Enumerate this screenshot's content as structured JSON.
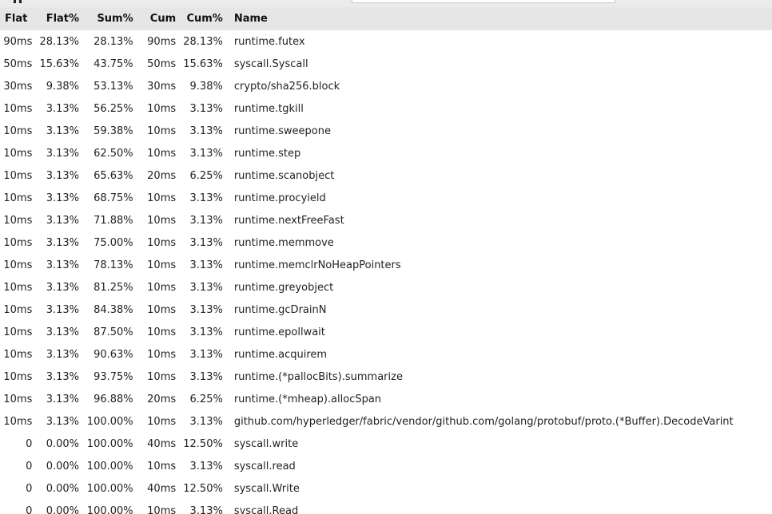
{
  "columns": [
    "Flat",
    "Flat%",
    "Sum%",
    "Cum",
    "Cum%",
    "Name"
  ],
  "rows": [
    {
      "flat": "90ms",
      "flat_pct": "28.13%",
      "sum_pct": "28.13%",
      "cum": "90ms",
      "cum_pct": "28.13%",
      "name": "runtime.futex"
    },
    {
      "flat": "50ms",
      "flat_pct": "15.63%",
      "sum_pct": "43.75%",
      "cum": "50ms",
      "cum_pct": "15.63%",
      "name": "syscall.Syscall"
    },
    {
      "flat": "30ms",
      "flat_pct": "9.38%",
      "sum_pct": "53.13%",
      "cum": "30ms",
      "cum_pct": "9.38%",
      "name": "crypto/sha256.block"
    },
    {
      "flat": "10ms",
      "flat_pct": "3.13%",
      "sum_pct": "56.25%",
      "cum": "10ms",
      "cum_pct": "3.13%",
      "name": "runtime.tgkill"
    },
    {
      "flat": "10ms",
      "flat_pct": "3.13%",
      "sum_pct": "59.38%",
      "cum": "10ms",
      "cum_pct": "3.13%",
      "name": "runtime.sweepone"
    },
    {
      "flat": "10ms",
      "flat_pct": "3.13%",
      "sum_pct": "62.50%",
      "cum": "10ms",
      "cum_pct": "3.13%",
      "name": "runtime.step"
    },
    {
      "flat": "10ms",
      "flat_pct": "3.13%",
      "sum_pct": "65.63%",
      "cum": "20ms",
      "cum_pct": "6.25%",
      "name": "runtime.scanobject"
    },
    {
      "flat": "10ms",
      "flat_pct": "3.13%",
      "sum_pct": "68.75%",
      "cum": "10ms",
      "cum_pct": "3.13%",
      "name": "runtime.procyield"
    },
    {
      "flat": "10ms",
      "flat_pct": "3.13%",
      "sum_pct": "71.88%",
      "cum": "10ms",
      "cum_pct": "3.13%",
      "name": "runtime.nextFreeFast"
    },
    {
      "flat": "10ms",
      "flat_pct": "3.13%",
      "sum_pct": "75.00%",
      "cum": "10ms",
      "cum_pct": "3.13%",
      "name": "runtime.memmove"
    },
    {
      "flat": "10ms",
      "flat_pct": "3.13%",
      "sum_pct": "78.13%",
      "cum": "10ms",
      "cum_pct": "3.13%",
      "name": "runtime.memclrNoHeapPointers"
    },
    {
      "flat": "10ms",
      "flat_pct": "3.13%",
      "sum_pct": "81.25%",
      "cum": "10ms",
      "cum_pct": "3.13%",
      "name": "runtime.greyobject"
    },
    {
      "flat": "10ms",
      "flat_pct": "3.13%",
      "sum_pct": "84.38%",
      "cum": "10ms",
      "cum_pct": "3.13%",
      "name": "runtime.gcDrainN"
    },
    {
      "flat": "10ms",
      "flat_pct": "3.13%",
      "sum_pct": "87.50%",
      "cum": "10ms",
      "cum_pct": "3.13%",
      "name": "runtime.epollwait"
    },
    {
      "flat": "10ms",
      "flat_pct": "3.13%",
      "sum_pct": "90.63%",
      "cum": "10ms",
      "cum_pct": "3.13%",
      "name": "runtime.acquirem"
    },
    {
      "flat": "10ms",
      "flat_pct": "3.13%",
      "sum_pct": "93.75%",
      "cum": "10ms",
      "cum_pct": "3.13%",
      "name": "runtime.(*pallocBits).summarize"
    },
    {
      "flat": "10ms",
      "flat_pct": "3.13%",
      "sum_pct": "96.88%",
      "cum": "20ms",
      "cum_pct": "6.25%",
      "name": "runtime.(*mheap).allocSpan"
    },
    {
      "flat": "10ms",
      "flat_pct": "3.13%",
      "sum_pct": "100.00%",
      "cum": "10ms",
      "cum_pct": "3.13%",
      "name": "github.com/hyperledger/fabric/vendor/github.com/golang/protobuf/proto.(*Buffer).DecodeVarint"
    },
    {
      "flat": "0",
      "flat_pct": "0.00%",
      "sum_pct": "100.00%",
      "cum": "40ms",
      "cum_pct": "12.50%",
      "name": "syscall.write"
    },
    {
      "flat": "0",
      "flat_pct": "0.00%",
      "sum_pct": "100.00%",
      "cum": "10ms",
      "cum_pct": "3.13%",
      "name": "syscall.read"
    },
    {
      "flat": "0",
      "flat_pct": "0.00%",
      "sum_pct": "100.00%",
      "cum": "40ms",
      "cum_pct": "12.50%",
      "name": "syscall.Write"
    },
    {
      "flat": "0",
      "flat_pct": "0.00%",
      "sum_pct": "100.00%",
      "cum": "10ms",
      "cum_pct": "3.13%",
      "name": "syscall.Read"
    }
  ]
}
